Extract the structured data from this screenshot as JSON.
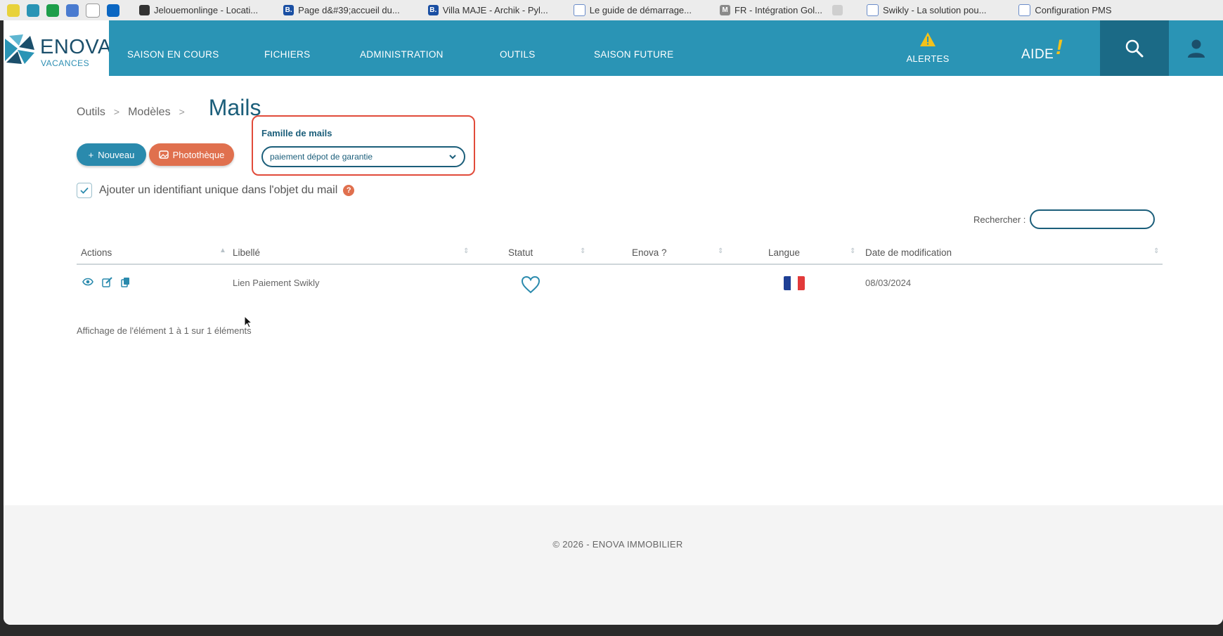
{
  "bookmarks": [
    {
      "label": "Jelouemonlinge - Locati...",
      "color": "#333333",
      "letter": ""
    },
    {
      "label": "Page d&#39;accueil du...",
      "color": "#1a4fa3",
      "letter": "B."
    },
    {
      "label": "Villa MAJE - Archik - Pyl...",
      "color": "#1a4fa3",
      "letter": "B."
    },
    {
      "label": "Le guide de démarrage...",
      "color": "#6a8cc9",
      "letter": ""
    },
    {
      "label": "FR - Intégration Gol...",
      "color": "#8a8a8a",
      "letter": "M"
    },
    {
      "label": "Swikly - La solution pou...",
      "color": "#6a8cc9",
      "letter": ""
    },
    {
      "label": "Configuration PMS",
      "color": "#6a8cc9",
      "letter": ""
    }
  ],
  "brand": {
    "name": "ENOVA",
    "sub": "VACANCES",
    "nav_color": "#2a94b5",
    "dark_color": "#1b6a86",
    "accent": "#e0704e"
  },
  "nav": {
    "items": [
      "SAISON EN COURS",
      "FICHIERS",
      "ADMINISTRATION",
      "OUTILS",
      "SAISON FUTURE"
    ],
    "alerts": "ALERTES",
    "aide": "AIDE",
    "aide_bang": "!"
  },
  "breadcrumb": {
    "items": [
      "Outils",
      "Modèles"
    ],
    "separator": ">",
    "title": "Mails"
  },
  "buttons": {
    "new": "Nouveau",
    "new_icon": "+",
    "photo": "Photothèque"
  },
  "family": {
    "label": "Famille de mails",
    "selected": "paiement dépot de garantie"
  },
  "checkbox": {
    "label": "Ajouter un identifiant unique dans l'objet du mail",
    "checked": true,
    "help": "?"
  },
  "search": {
    "label": "Rechercher :",
    "value": ""
  },
  "table": {
    "columns": [
      "Actions",
      "Libellé",
      "Statut",
      "Enova ?",
      "Langue",
      "Date de modification"
    ],
    "rows": [
      {
        "libelle": "Lien Paiement Swikly",
        "statut": "heart-icon",
        "enova": "",
        "langue": "fr",
        "date": "08/03/2024"
      }
    ],
    "info": "Affichage de l'élément 1 à 1 sur 1 éléments"
  },
  "footer": {
    "text": "© 2026 - ENOVA IMMOBILIER"
  }
}
